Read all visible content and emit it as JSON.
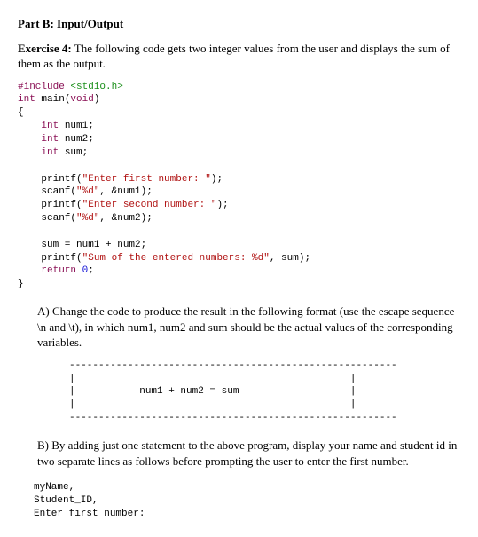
{
  "heading": "Part B: Input/Output",
  "exercise": {
    "lead": "Exercise 4:",
    "prompt": "The following code gets two integer values from the user and displays the sum of them as the output."
  },
  "code": {
    "l1a": "#include",
    "l1b": "<stdio.h>",
    "l2a": "int",
    "l2b": " main(",
    "l2c": "void",
    "l2d": ")",
    "l3": "{",
    "l4a": "int",
    "l4b": " num1;",
    "l5a": "int",
    "l5b": " num2;",
    "l6a": "int",
    "l6b": " sum;",
    "blank1": "",
    "l7a": "    printf(",
    "l7b": "\"Enter first number: \"",
    "l7c": ");",
    "l8a": "    scanf(",
    "l8b": "\"%d\"",
    "l8c": ", &num1);",
    "l9a": "    printf(",
    "l9b": "\"Enter second number: \"",
    "l9c": ");",
    "l10a": "    scanf(",
    "l10b": "\"%d\"",
    "l10c": ", &num2);",
    "blank2": "",
    "l11": "    sum = num1 + num2;",
    "l12a": "    printf(",
    "l12b": "\"Sum of the entered numbers: %d\"",
    "l12c": ", sum);",
    "l13a": "return",
    "l13b": " ",
    "l13c": "0",
    "l13d": ";",
    "l14": "}"
  },
  "partA": {
    "label": "A)",
    "text": "Change the code to produce the result in the following format (use the escape sequence \\n and \\t), in which num1, num2 and sum should be the actual values of the corresponding variables."
  },
  "outputBox": {
    "topDash": "--------------------------------------------------------",
    "row1": "|                                               |",
    "row2": "|           num1 + num2 = sum                   |",
    "row3": "|                                               |",
    "botDash": "--------------------------------------------------------"
  },
  "partB": {
    "label": "B)",
    "text": "By adding just one statement to the above program, display your name and student id in two separate lines as follows before prompting the user to enter the first number."
  },
  "sampleOut": {
    "l1": "myName,",
    "l2": "Student_ID,",
    "l3": "Enter first number:"
  }
}
